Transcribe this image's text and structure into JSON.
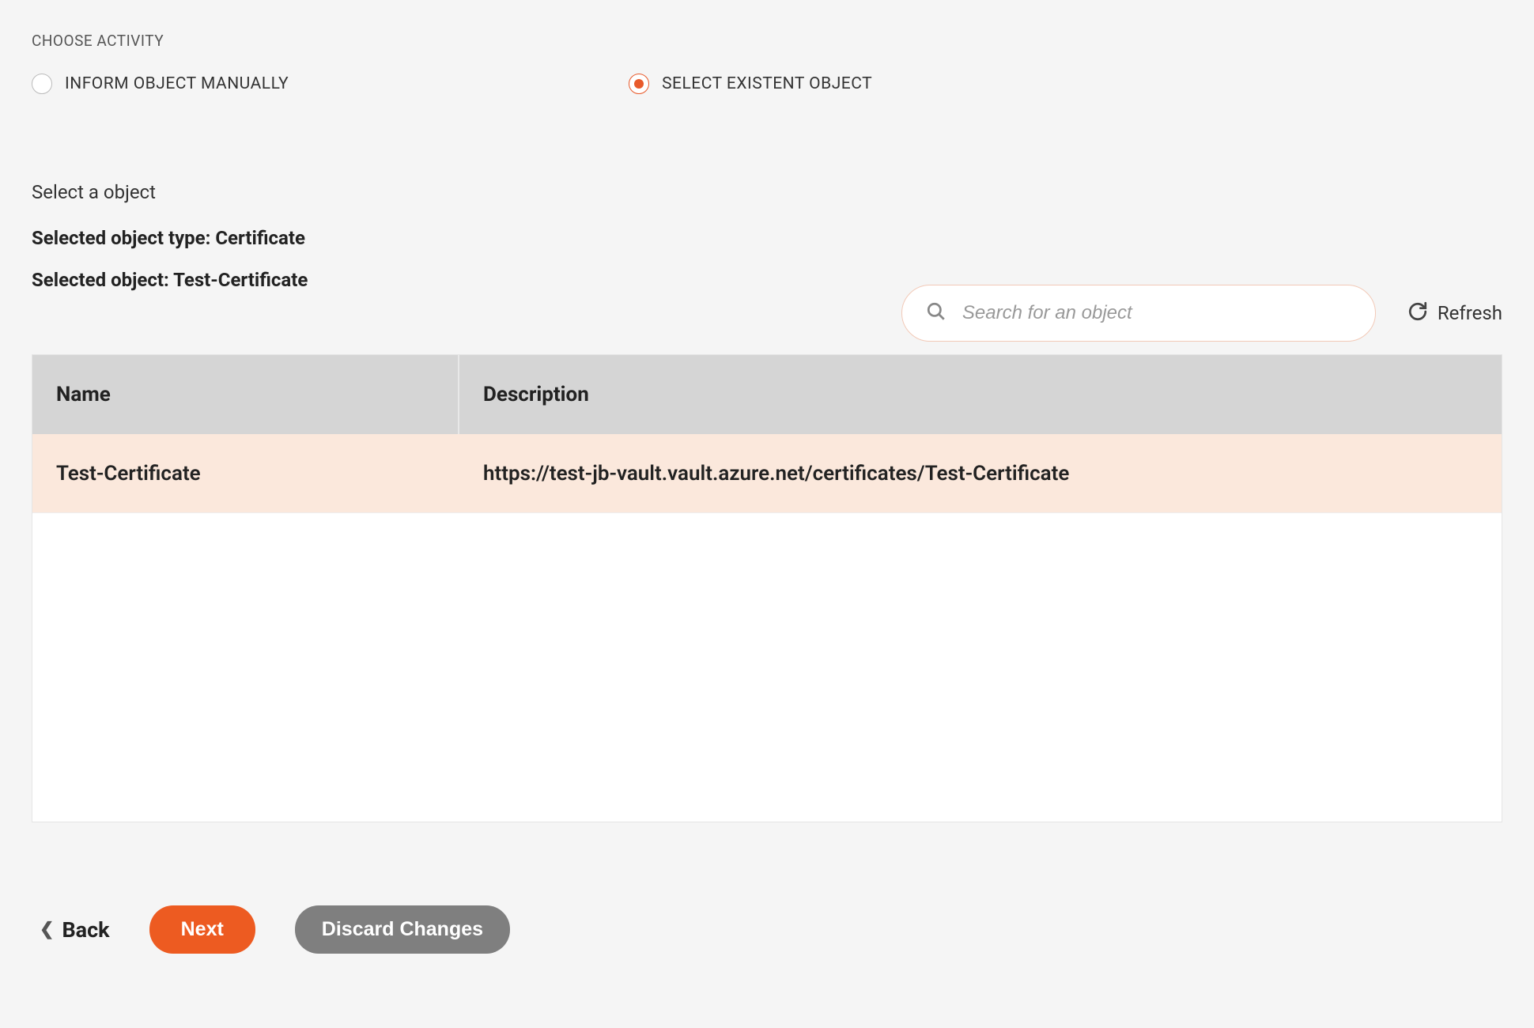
{
  "section_label": "CHOOSE ACTIVITY",
  "radios": {
    "manual": {
      "label": "INFORM OBJECT MANUALLY",
      "selected": false
    },
    "existent": {
      "label": "SELECT EXISTENT OBJECT",
      "selected": true
    }
  },
  "select_object_label": "Select a object",
  "selected_object_type_line": "Selected object type: Certificate",
  "selected_object_line": "Selected object: Test-Certificate",
  "search": {
    "placeholder": "Search for an object"
  },
  "refresh_label": "Refresh",
  "table": {
    "headers": {
      "name": "Name",
      "description": "Description"
    },
    "rows": [
      {
        "name": "Test-Certificate",
        "description": "https://test-jb-vault.vault.azure.net/certificates/Test-Certificate",
        "selected": true
      }
    ]
  },
  "footer": {
    "back": "Back",
    "next": "Next",
    "discard": "Discard Changes"
  }
}
